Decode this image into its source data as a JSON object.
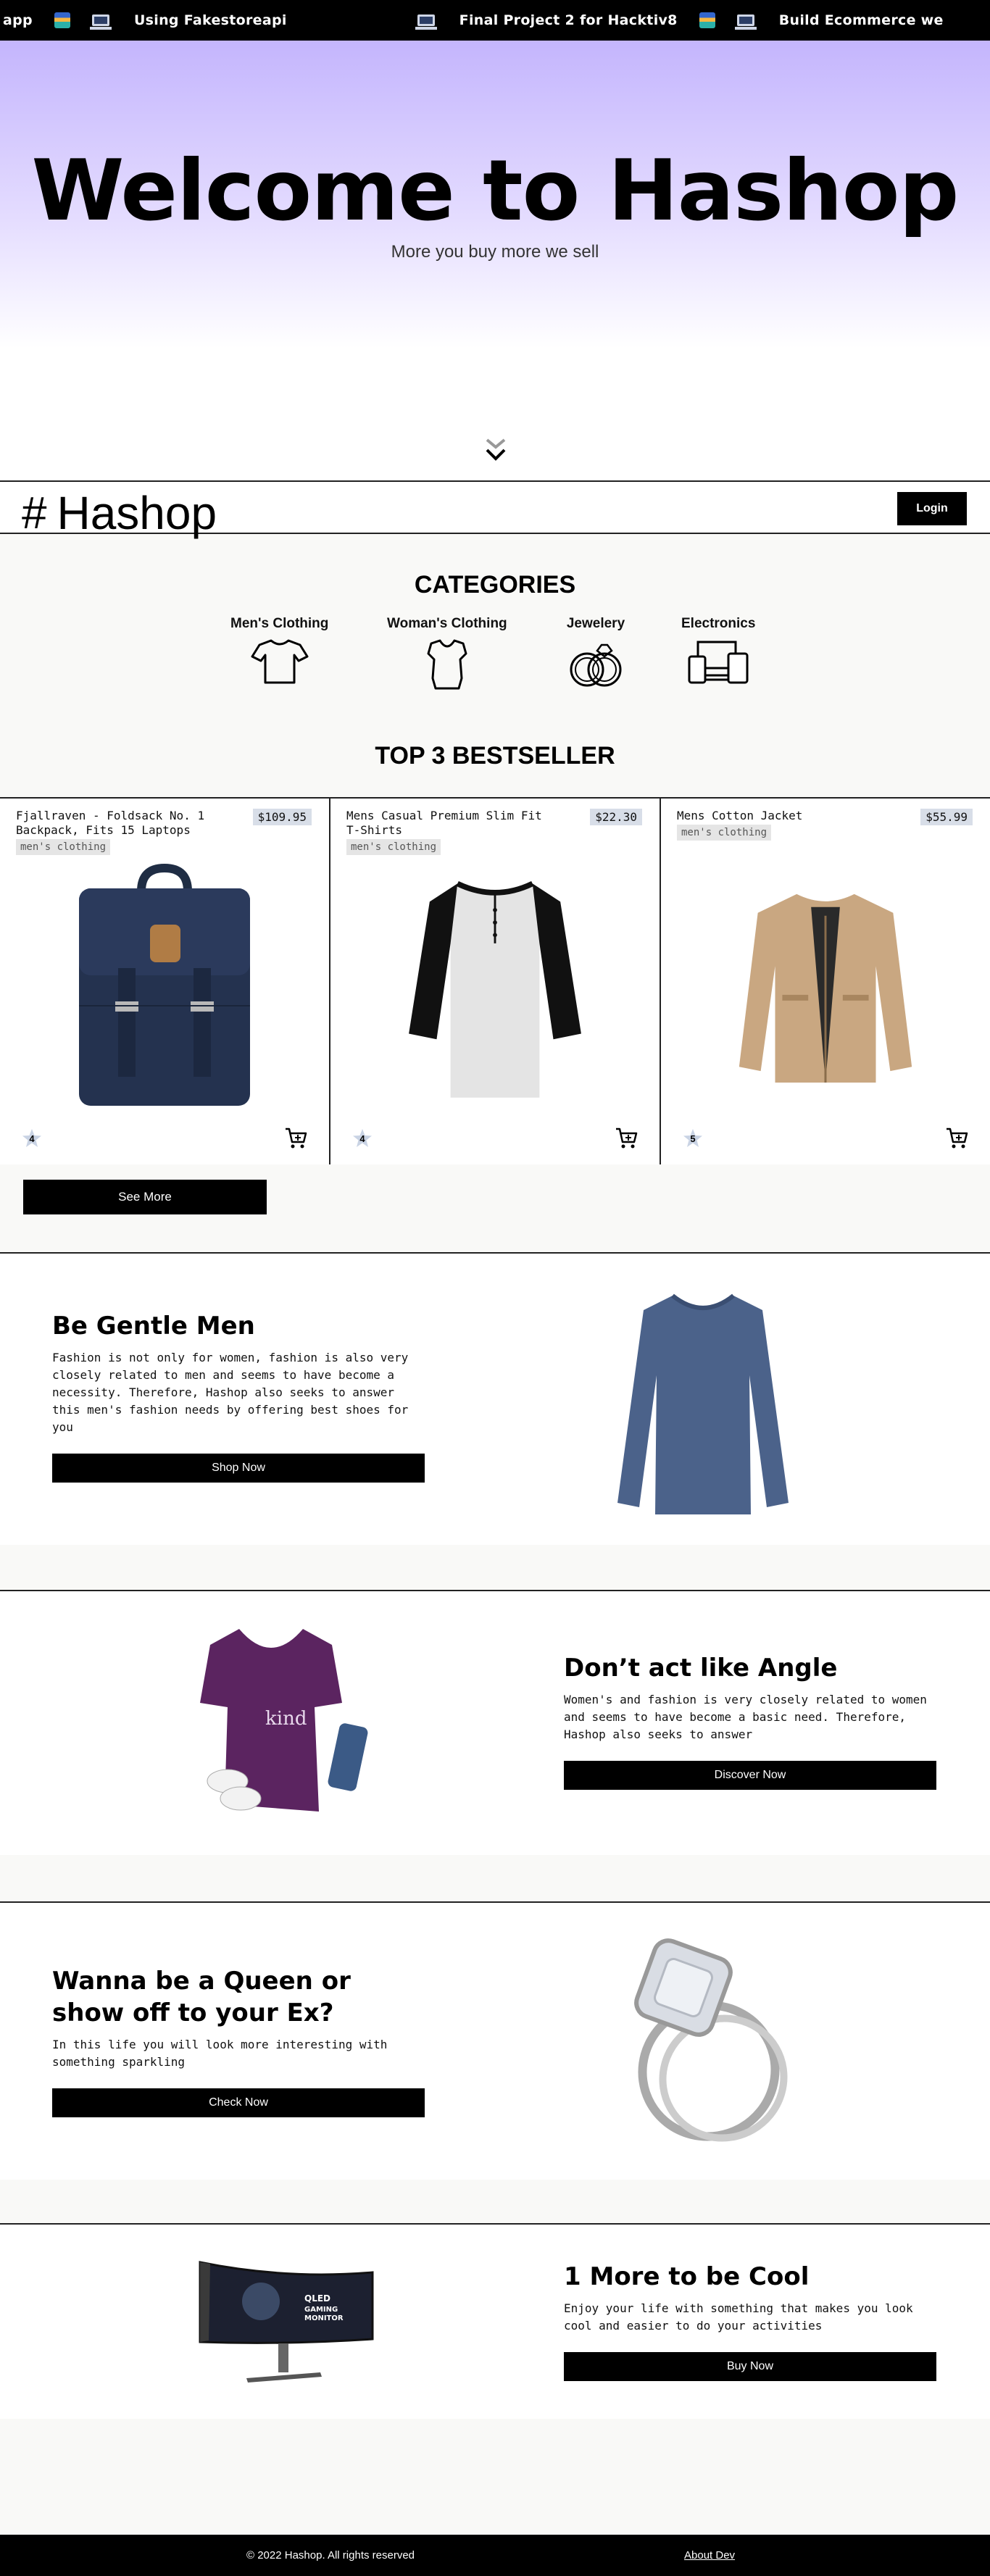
{
  "marquee": {
    "items": [
      "eb app",
      "Using Fakestoreapi",
      "Final Project 2 for Hacktiv8",
      "Build Ecommerce we"
    ]
  },
  "hero": {
    "title": "Welcome to Hashop",
    "subtitle": "More you buy more we sell",
    "scroll_icon": "double-chevron-down-icon"
  },
  "navbar": {
    "brand_symbol": "#",
    "brand_name": "Hashop",
    "login_label": "Login"
  },
  "categories": {
    "title": "CATEGORIES",
    "items": [
      {
        "label": "Men's Clothing",
        "icon": "tshirt-icon"
      },
      {
        "label": "Woman's Clothing",
        "icon": "blouse-icon"
      },
      {
        "label": "Jewelery",
        "icon": "rings-icon"
      },
      {
        "label": "Electronics",
        "icon": "devices-icon"
      }
    ]
  },
  "bestseller": {
    "title": "TOP 3 BESTSELLER",
    "products": [
      {
        "title": "Fjallraven - Foldsack No. 1 Backpack, Fits 15 Laptops",
        "category": "men's clothing",
        "price": "$109.95",
        "rating": "4"
      },
      {
        "title": "Mens Casual Premium Slim Fit T-Shirts",
        "category": "men's clothing",
        "price": "$22.30",
        "rating": "4"
      },
      {
        "title": "Mens Cotton Jacket",
        "category": "men's clothing",
        "price": "$55.99",
        "rating": "5"
      }
    ],
    "see_more_label": "See More"
  },
  "promos": [
    {
      "title": "Be Gentle Men",
      "desc": "Fashion is not only for women, fashion is also very closely related to men and seems to have become a necessity. Therefore, Hashop also seeks to answer this men's fashion needs by offering best shoes for you",
      "button": "Shop Now"
    },
    {
      "title": "Don’t act like Angle",
      "desc": "Women's and fashion is very closely related to women and seems to have become a basic need. Therefore, Hashop also seeks to answer",
      "button": "Discover Now"
    },
    {
      "title": "Wanna be a Queen or show off to your Ex?",
      "desc": "In this life you will look more interesting with something sparkling",
      "button": "Check Now"
    },
    {
      "title": "1 More to be Cool",
      "desc": "Enjoy your life with something that makes you look cool and easier to do your activities",
      "button": "Buy Now"
    }
  ],
  "footer": {
    "copyright": "© 2022 Hashop. All rights reserved",
    "about_link": "About Dev"
  },
  "colors": {
    "hero_gradient_top": "#c4b5fd",
    "accent_dark": "#000000",
    "price_badge": "#d8dee8"
  }
}
